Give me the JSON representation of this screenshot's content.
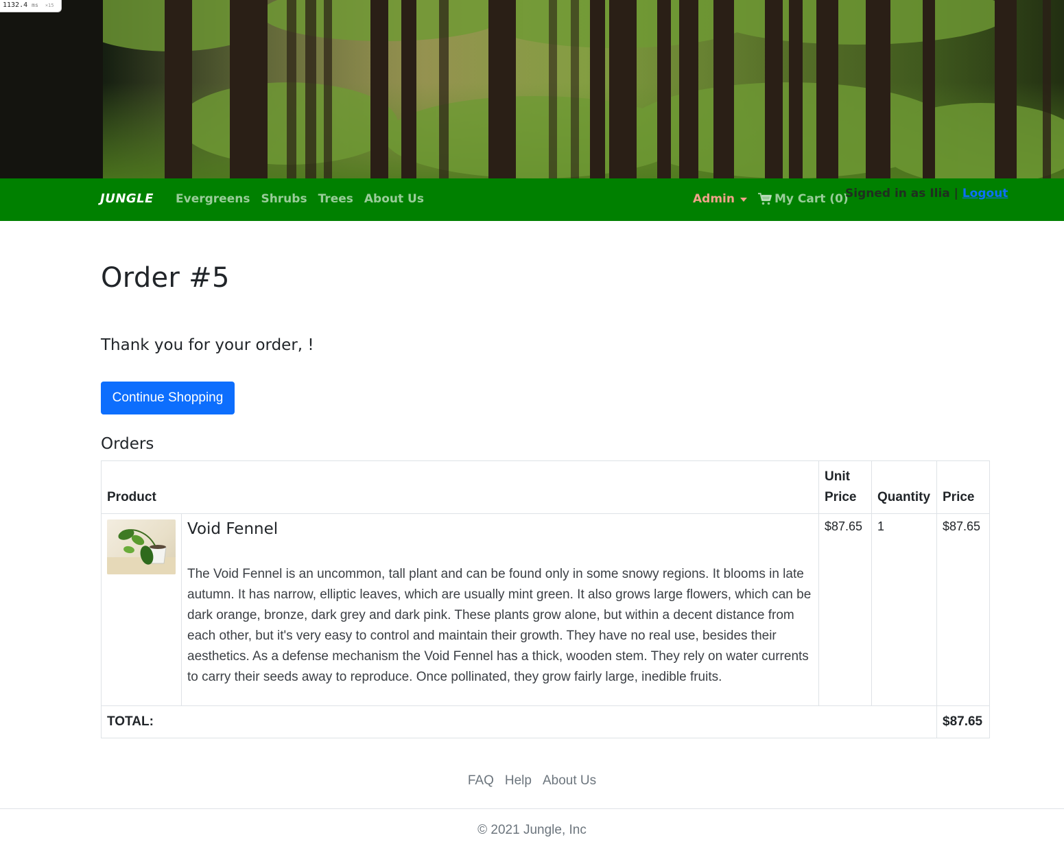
{
  "perf": {
    "value": "1132.4",
    "unit": "ms",
    "multiplier": "×15"
  },
  "navbar": {
    "brand": "JUNGLE",
    "links": [
      "Evergreens",
      "Shrubs",
      "Trees",
      "About Us"
    ],
    "admin_label": "Admin",
    "cart_label": "My Cart (0)",
    "signed_in_text": "Signed in as Ilia | ",
    "logout_label": "Logout"
  },
  "page": {
    "title": "Order #5",
    "thanks": "Thank you for your order, !",
    "continue_button": "Continue Shopping",
    "orders_heading": "Orders"
  },
  "table": {
    "headers": {
      "product": "Product",
      "unit_price": "Unit Price",
      "quantity": "Quantity",
      "price": "Price"
    },
    "rows": [
      {
        "name": "Void Fennel",
        "description": "The Void Fennel is an uncommon, tall plant and can be found only in some snowy regions. It blooms in late autumn. It has narrow, elliptic leaves, which are usually mint green. It also grows large flowers, which can be dark orange, bronze, dark grey and dark pink. These plants grow alone, but within a decent distance from each other, but it's very easy to control and maintain their growth. They have no real use, besides their aesthetics. As a defense mechanism the Void Fennel has a thick, wooden stem. They rely on water currents to carry their seeds away to reproduce. Once pollinated, they grow fairly large, inedible fruits.",
        "unit_price": "$87.65",
        "quantity": "1",
        "price": "$87.65"
      }
    ],
    "total_label": "TOTAL:",
    "total_value": "$87.65"
  },
  "footer": {
    "links": [
      "FAQ",
      "Help",
      "About Us"
    ],
    "copyright": "© 2021 Jungle, Inc"
  },
  "colors": {
    "navbar": "#008000",
    "button": "#0d6efd",
    "admin": "#f2a28a"
  },
  "icons": {
    "cart": "shopping-cart-icon",
    "admin_caret": "caret-down-icon"
  }
}
